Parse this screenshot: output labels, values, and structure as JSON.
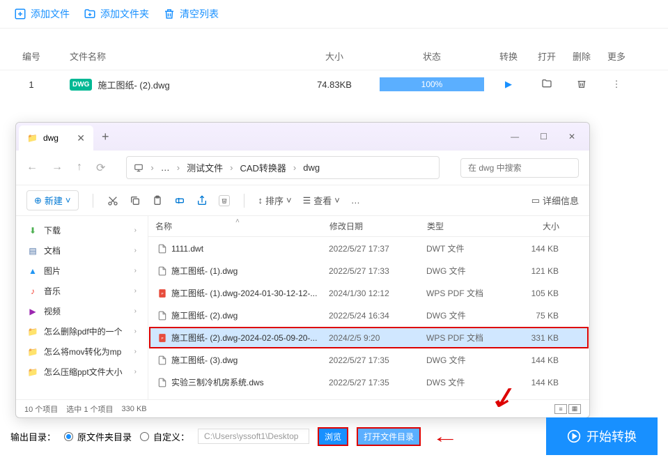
{
  "toolbar": {
    "add_file": "添加文件",
    "add_folder": "添加文件夹",
    "clear_list": "清空列表"
  },
  "table": {
    "headers": {
      "num": "编号",
      "name": "文件名称",
      "size": "大小",
      "status": "状态",
      "convert": "转换",
      "open": "打开",
      "delete": "删除",
      "more": "更多"
    },
    "rows": [
      {
        "num": "1",
        "badge": "DWG",
        "name": "施工图纸- (2).dwg",
        "size": "74.83KB",
        "progress": "100%"
      }
    ]
  },
  "explorer": {
    "tab_title": "dwg",
    "breadcrumb": [
      "测试文件",
      "CAD转换器",
      "dwg"
    ],
    "search_placeholder": "在 dwg 中搜索",
    "new_btn": "新建",
    "sort_btn": "排序",
    "view_btn": "查看",
    "details_btn": "详细信息",
    "sidebar": [
      {
        "icon": "download",
        "label": "下载",
        "color": "#4caf50"
      },
      {
        "icon": "doc",
        "label": "文档",
        "color": "#4a6fa5"
      },
      {
        "icon": "pic",
        "label": "图片",
        "color": "#2196f3"
      },
      {
        "icon": "music",
        "label": "音乐",
        "color": "#f44336"
      },
      {
        "icon": "video",
        "label": "视频",
        "color": "#9c27b0"
      },
      {
        "icon": "folder",
        "label": "怎么删除pdf中的一个",
        "color": "#f7b500"
      },
      {
        "icon": "folder",
        "label": "怎么将mov转化为mp",
        "color": "#f7b500"
      },
      {
        "icon": "folder",
        "label": "怎么压缩ppt文件大小",
        "color": "#f7b500"
      }
    ],
    "columns": {
      "name": "名称",
      "date": "修改日期",
      "type": "类型",
      "size": "大小"
    },
    "files": [
      {
        "icon": "file",
        "name": "1111.dwt",
        "date": "2022/5/27 17:37",
        "type": "DWT 文件",
        "size": "144 KB"
      },
      {
        "icon": "file",
        "name": "施工图纸- (1).dwg",
        "date": "2022/5/27 17:33",
        "type": "DWG 文件",
        "size": "121 KB"
      },
      {
        "icon": "pdf",
        "name": "施工图纸- (1).dwg-2024-01-30-12-12-...",
        "date": "2024/1/30 12:12",
        "type": "WPS PDF 文档",
        "size": "105 KB"
      },
      {
        "icon": "file",
        "name": "施工图纸- (2).dwg",
        "date": "2022/5/24 16:34",
        "type": "DWG 文件",
        "size": "75 KB"
      },
      {
        "icon": "pdf",
        "name": "施工图纸- (2).dwg-2024-02-05-09-20-...",
        "date": "2024/2/5 9:20",
        "type": "WPS PDF 文档",
        "size": "331 KB",
        "selected": true
      },
      {
        "icon": "file",
        "name": "施工图纸- (3).dwg",
        "date": "2022/5/27 17:35",
        "type": "DWG 文件",
        "size": "144 KB"
      },
      {
        "icon": "file",
        "name": "实验三制冷机房系统.dws",
        "date": "2022/5/27 17:35",
        "type": "DWS 文件",
        "size": "144 KB"
      }
    ],
    "status": {
      "count": "10 个项目",
      "selected": "选中 1 个项目",
      "size": "330 KB"
    }
  },
  "bottom": {
    "output_label": "输出目录：",
    "original": "原文件夹目录",
    "custom": "自定义：",
    "path": "C:\\Users\\yssoft1\\Desktop",
    "browse": "浏览",
    "open_dir": "打开文件目录",
    "start": "开始转换"
  }
}
